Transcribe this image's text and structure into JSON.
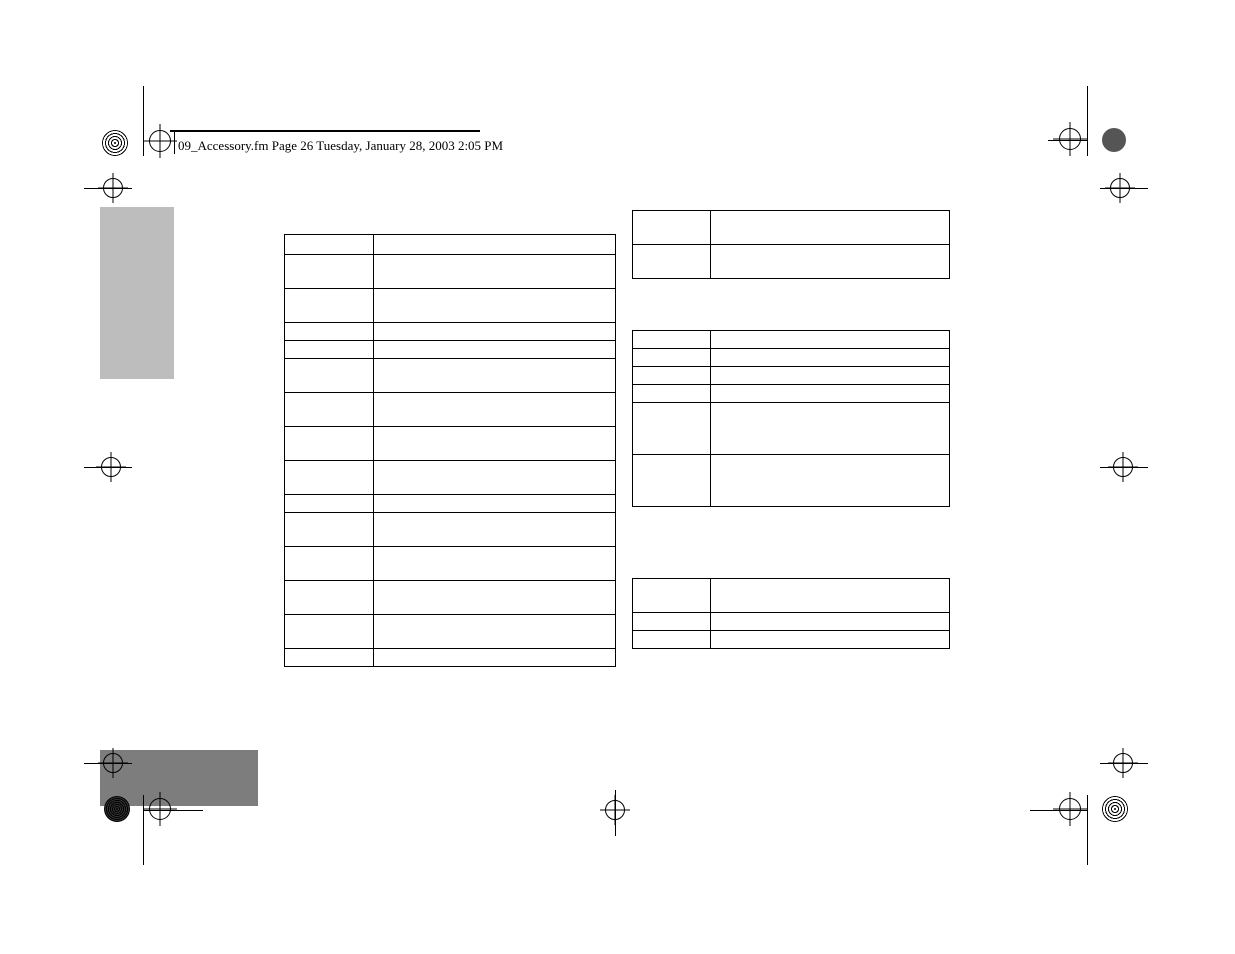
{
  "header_text": "09_Accessory.fm  Page 26  Tuesday, January 28, 2003  2:05 PM",
  "left_table_row_heights": [
    20,
    34,
    34,
    18,
    18,
    34,
    34,
    34,
    34,
    18,
    34,
    34,
    34,
    34,
    18
  ],
  "top_right_table_row_heights": [
    34,
    34
  ],
  "mid_right_table_row_heights": [
    18,
    18,
    18,
    18,
    52,
    52
  ],
  "bot_right_table_row_heights": [
    34,
    18,
    18
  ]
}
